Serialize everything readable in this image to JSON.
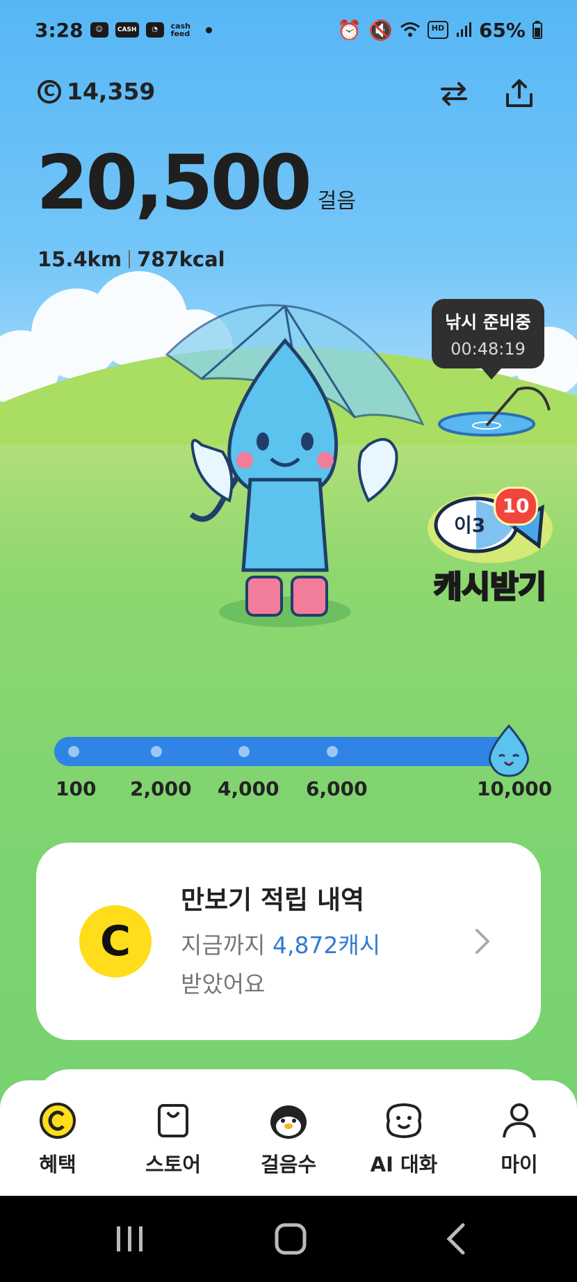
{
  "status_bar": {
    "time": "3:28",
    "cash_label": "CASH",
    "feed_label": "cash feed",
    "battery": "65%"
  },
  "header": {
    "cash_symbol": "C",
    "cash_balance": "14,359"
  },
  "steps": {
    "count": "20,500",
    "unit": "걸음",
    "distance": "15.4km",
    "calories": "787kcal"
  },
  "fishing": {
    "title": "낚시 준비중",
    "timer": "00:48:19"
  },
  "cash_receive": {
    "label": "캐시받기",
    "badge": "10",
    "fish_text": "이3"
  },
  "progress": {
    "fraction": 1.0,
    "labels": [
      "100",
      "2,000",
      "4,000",
      "6,000",
      "10,000"
    ]
  },
  "history_card": {
    "coin_symbol": "C",
    "title": "만보기 적립 내역",
    "desc_prefix": "지금까지",
    "desc_amount": "4,872캐시",
    "desc_suffix": "받았어요"
  },
  "bottom_nav": [
    {
      "label": "혜택",
      "icon": "coin-icon"
    },
    {
      "label": "스토어",
      "icon": "shopping-bag-icon"
    },
    {
      "label": "걸음수",
      "icon": "penguin-icon"
    },
    {
      "label": "AI 대화",
      "icon": "smile-face-icon"
    },
    {
      "label": "마이",
      "icon": "person-icon"
    }
  ],
  "colors": {
    "sky": "#56b6f5",
    "grass": "#7ad370",
    "progress": "#2f84e6",
    "coin": "#ffdd1a",
    "highlight": "#2e7bd6"
  }
}
